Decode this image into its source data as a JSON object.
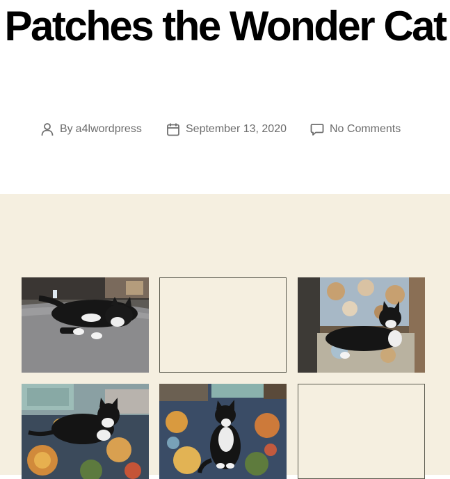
{
  "post": {
    "title": "Patches the Wonder Cat",
    "author_prefix": "By",
    "author": "a4lwordpress",
    "date": "September 13, 2020",
    "comments": "No Comments"
  },
  "icons": {
    "author": "person-icon",
    "date": "calendar-icon",
    "comments": "speech-bubble-icon"
  },
  "colors": {
    "content_background": "#f5efe0",
    "meta_text": "#6d6d6d"
  },
  "gallery": {
    "images": [
      {
        "alt": "cat lying on gray ottoman",
        "loaded": true
      },
      {
        "alt": "",
        "loaded": false
      },
      {
        "alt": "cat sitting on floral chair",
        "loaded": true
      },
      {
        "alt": "cat lying on patterned rug",
        "loaded": true
      },
      {
        "alt": "cat sitting on patterned rug",
        "loaded": true
      },
      {
        "alt": "",
        "loaded": false
      }
    ]
  }
}
